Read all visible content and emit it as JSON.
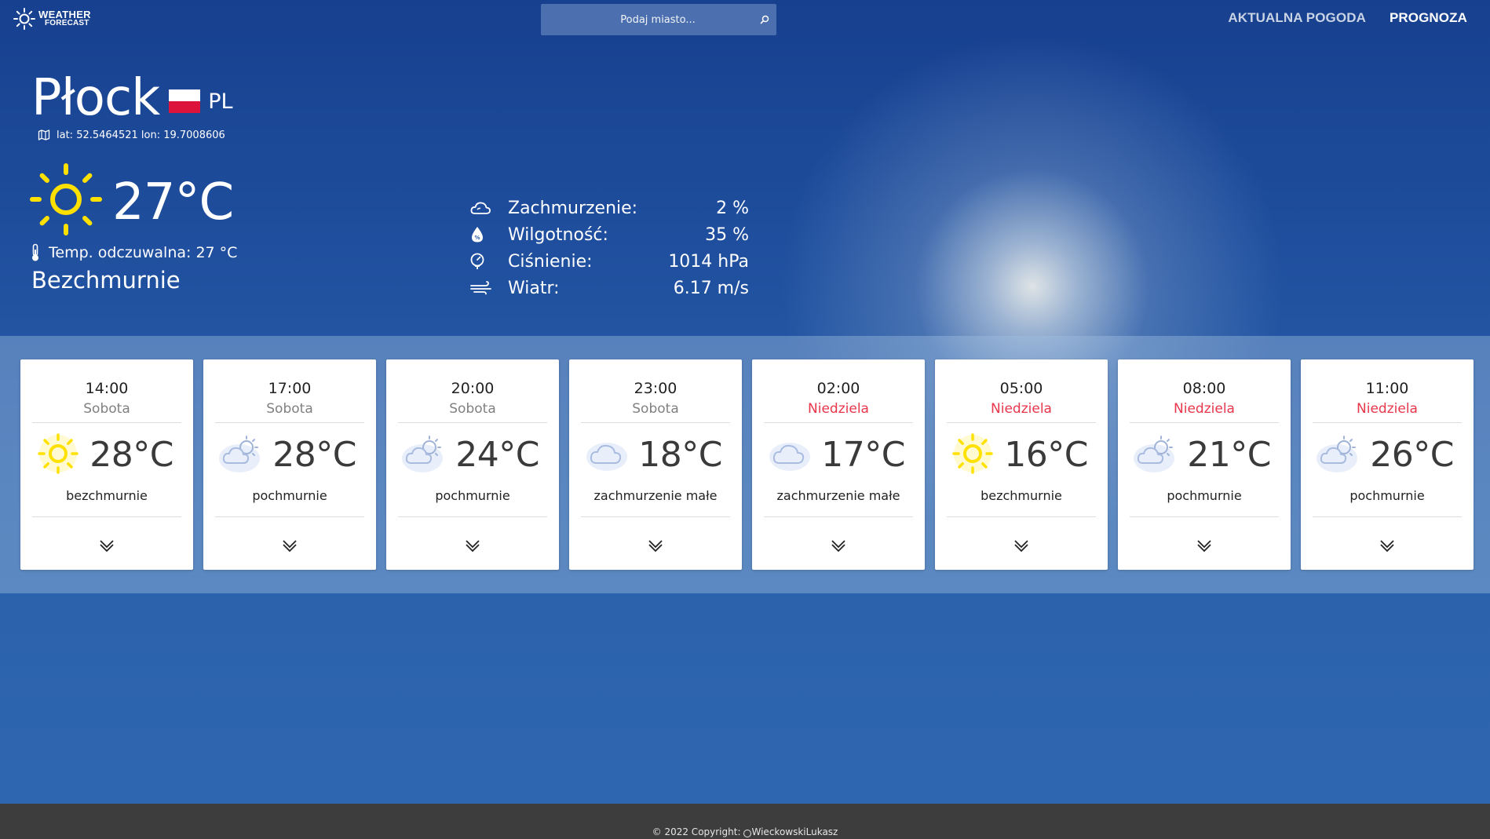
{
  "header": {
    "logo_line1": "WEATHER",
    "logo_line2": "FORECAST",
    "search_placeholder": "Podaj miasto...",
    "nav": [
      {
        "label": "AKTUALNA POGODA"
      },
      {
        "label": "PROGNOZA"
      }
    ]
  },
  "current": {
    "city": "Płock",
    "country": "PL",
    "coords": "lat: 52.5464521  lon: 19.7008606",
    "temperature": "27°C",
    "feels_like": "Temp. odczuwalna: 27 °C",
    "description": "Bezchmurnie",
    "icon": "sun-icon",
    "stats": [
      {
        "icon": "cloud-icon",
        "label": "Zachmurzenie:",
        "value": "2 %"
      },
      {
        "icon": "humidity-icon",
        "label": "Wilgotność:",
        "value": "35 %"
      },
      {
        "icon": "pressure-icon",
        "label": "Ciśnienie:",
        "value": "1014 hPa"
      },
      {
        "icon": "wind-icon",
        "label": "Wiatr:",
        "value": "6.17 m/s"
      }
    ]
  },
  "forecast": [
    {
      "time": "14:00",
      "day": "Sobota",
      "temp": "28°C",
      "desc": "bezchmurnie",
      "icon": "sun-icon"
    },
    {
      "time": "17:00",
      "day": "Sobota",
      "temp": "28°C",
      "desc": "pochmurnie",
      "icon": "cloud-sun-icon"
    },
    {
      "time": "20:00",
      "day": "Sobota",
      "temp": "24°C",
      "desc": "pochmurnie",
      "icon": "cloud-sun-icon"
    },
    {
      "time": "23:00",
      "day": "Sobota",
      "temp": "18°C",
      "desc": "zachmurzenie małe",
      "icon": "cloud-icon"
    },
    {
      "time": "02:00",
      "day": "Niedziela",
      "temp": "17°C",
      "desc": "zachmurzenie małe",
      "icon": "cloud-icon"
    },
    {
      "time": "05:00",
      "day": "Niedziela",
      "temp": "16°C",
      "desc": "bezchmurnie",
      "icon": "sun-icon"
    },
    {
      "time": "08:00",
      "day": "Niedziela",
      "temp": "21°C",
      "desc": "pochmurnie",
      "icon": "cloud-sun-icon"
    },
    {
      "time": "11:00",
      "day": "Niedziela",
      "temp": "26°C",
      "desc": "pochmurnie",
      "icon": "cloud-sun-icon"
    }
  ],
  "footer": {
    "copyright": "© 2022 Copyright:",
    "author": "WieckowskiLukasz"
  },
  "colors": {
    "sun": "#ffe100",
    "next_day": "#e8364b",
    "card_bg": "#ffffff",
    "footer_bg": "#3d3d3e"
  }
}
